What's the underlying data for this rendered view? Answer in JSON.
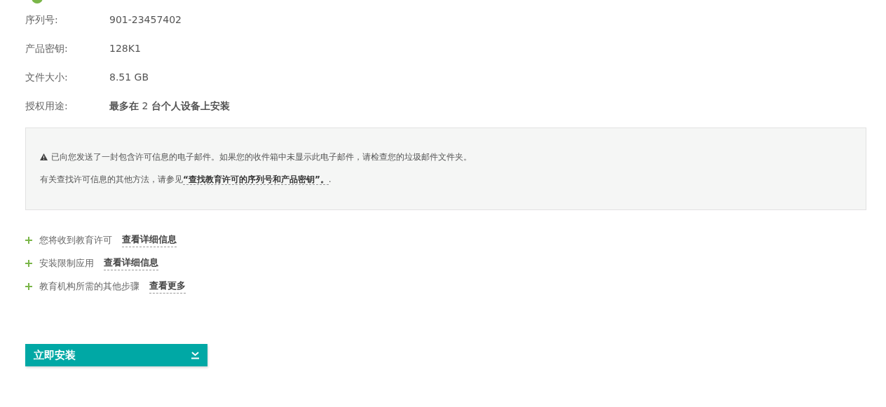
{
  "details": [
    {
      "label": "序列号:",
      "value": "901-23457402"
    },
    {
      "label": "产品密钥:",
      "value": "128K1"
    },
    {
      "label": "文件大小:",
      "value": "8.51 GB"
    },
    {
      "label": "授权用途:",
      "value": "**最多在** 2 **台个人设备上安装**"
    }
  ],
  "notice": {
    "warning": "已向您发送了一封包含许可信息的电子邮件。如果您的收件箱中未显示此电子邮件，请检查您的垃圾邮件文件夹。",
    "info": "有关查找许可信息的其他方法，请参见",
    "link": "“查找教育许可的序列号和产品密钥”。",
    "after_link": "."
  },
  "expanders": [
    {
      "text": "您将收到教育许可",
      "link": "查看详细信息",
      "expanded": false
    },
    {
      "text": "安装限制应用",
      "link": "查看详细信息",
      "expanded": false
    },
    {
      "text": "教育机构所需的其他步骤",
      "link": "查看更多",
      "expanded": false
    }
  ],
  "install_button": {
    "label": "立即安装"
  }
}
